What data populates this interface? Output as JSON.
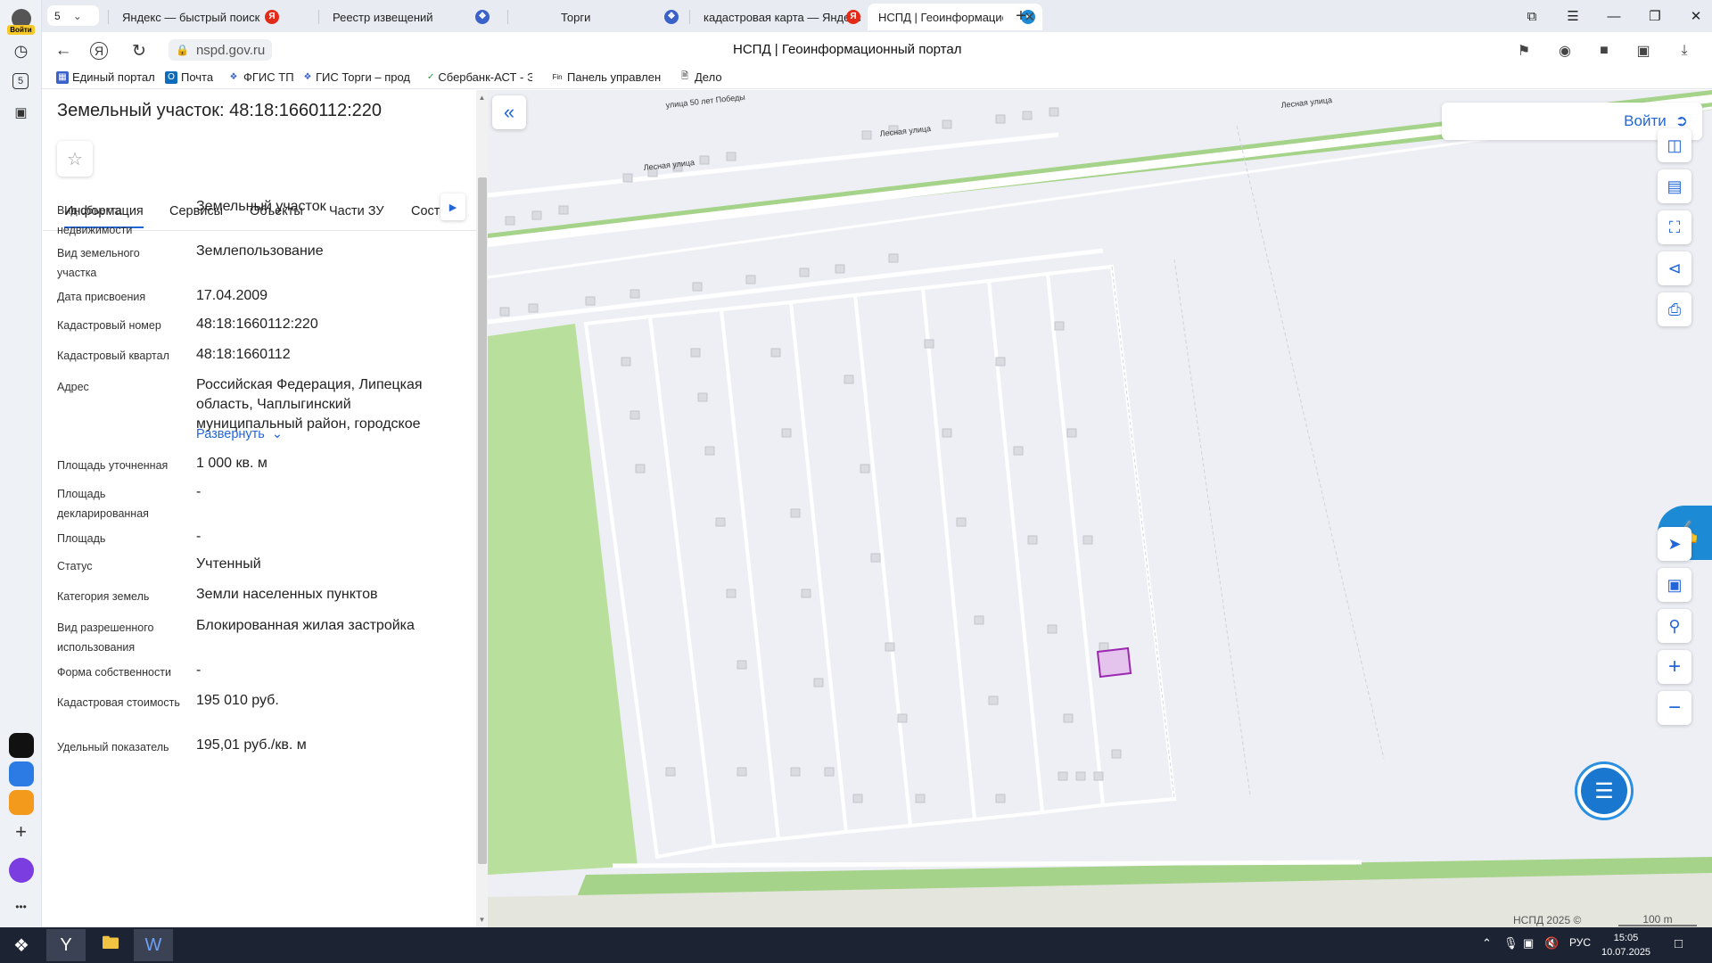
{
  "browser": {
    "account_label": "Войти",
    "tab_count": "5",
    "tabs": [
      {
        "title": "Яндекс — быстрый поиск",
        "icon": "yandex-icon",
        "color": "#e32b1a"
      },
      {
        "title": "Реестр извещений",
        "icon": "gerb-icon",
        "color": "#3a62c9"
      },
      {
        "title": "Торги",
        "icon": "gerb-icon",
        "color": "#3a62c9"
      },
      {
        "title": "кадастровая карта — Яндекс",
        "icon": "yandex-icon",
        "color": "#e32b1a"
      },
      {
        "title": "НСПД | Геоинформационный портал",
        "icon": "nspd-icon",
        "color": "#1d8ad6"
      }
    ],
    "url": "nspd.gov.ru",
    "page_title": "НСПД | Геоинформационный портал",
    "bookmarks": [
      {
        "label": "Единый портал",
        "icon": "gosuslugi-icon"
      },
      {
        "label": "Почта",
        "icon": "outlook-icon"
      },
      {
        "label": "ФГИС ТП",
        "icon": "gerb-icon"
      },
      {
        "label": "ГИС Торги – прод",
        "icon": "gerb-icon"
      },
      {
        "label": "Сбербанк-АСТ - Э",
        "icon": "sber-icon"
      },
      {
        "label": "Панель управлен",
        "icon": "fin-icon"
      },
      {
        "label": "Дело",
        "icon": "document-icon"
      }
    ]
  },
  "panel": {
    "title": "Земельный участок: 48:18:1660112:220",
    "tabs": [
      "Информация",
      "Сервисы",
      "Объекты",
      "Части ЗУ",
      "Соста"
    ],
    "fields": [
      {
        "label": "Вид объекта недвижимости",
        "value": "Земельный участок"
      },
      {
        "label": "Вид земельного участка",
        "value": "Землепользование"
      },
      {
        "label": "Дата присвоения",
        "value": "17.04.2009"
      },
      {
        "label": "Кадастровый номер",
        "value": "48:18:1660112:220"
      },
      {
        "label": "Кадастровый квартал",
        "value": "48:18:1660112"
      },
      {
        "label": "Адрес",
        "value": "Российская Федерация, Липецкая область, Чаплыгинский муниципальный район, городское"
      },
      {
        "label": "Площадь уточненная",
        "value": "1 000 кв. м"
      },
      {
        "label": "Площадь декларированная",
        "value": "-"
      },
      {
        "label": "Площадь",
        "value": "-"
      },
      {
        "label": "Статус",
        "value": "Учтенный"
      },
      {
        "label": "Категория земель",
        "value": "Земли населенных пунктов"
      },
      {
        "label": "Вид разрешенного использования",
        "value": "Блокированная жилая застройка"
      },
      {
        "label": "Форма собственности",
        "value": "-"
      },
      {
        "label": "Кадастровая стоимость",
        "value": "195 010 руб."
      },
      {
        "label": "Удельный показатель",
        "value": "195,01 руб./кв. м"
      }
    ],
    "expand_label": "Развернуть"
  },
  "map": {
    "login_label": "Войти",
    "streets": [
      "улица 50 лет Победы",
      "Лесная улица",
      "Лесная улица",
      "Лесная улица"
    ],
    "copyright": "НСПД 2025 ©",
    "scale": "100 m",
    "highlight_color": "#e4c4ec"
  },
  "taskbar": {
    "lang": "РУС",
    "time": "15:05",
    "date": "10.07.2025"
  }
}
